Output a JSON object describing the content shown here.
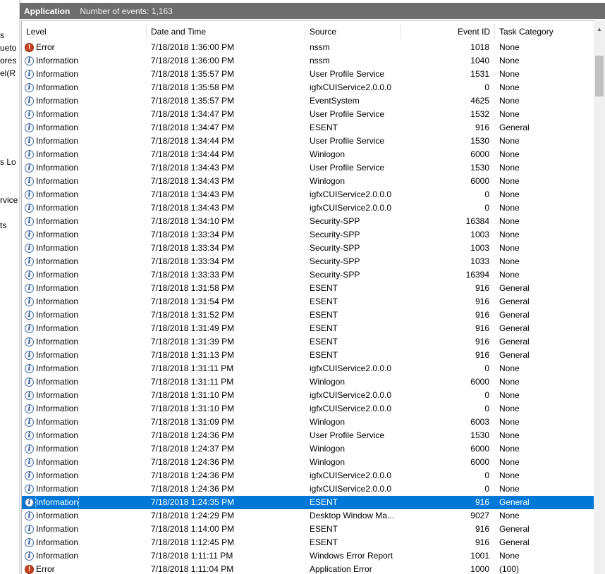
{
  "left_tree": [
    "s",
    "ueto",
    "ores",
    "el(R",
    "s Lo",
    "rvice",
    "ts"
  ],
  "header": {
    "log_name": "Application",
    "event_count": "Number of events: 1,163"
  },
  "columns": {
    "level": "Level",
    "date": "Date and Time",
    "source": "Source",
    "event_id": "Event ID",
    "task_category": "Task Category"
  },
  "icons": {
    "information": "information-icon",
    "error": "error-icon"
  },
  "colors": {
    "selection": "#0078d7",
    "header_bar": "#6d6d6d",
    "error_icon": "#c7421f"
  },
  "events": [
    {
      "level": "Error",
      "date": "7/18/2018 1:36:00 PM",
      "source": "nssm",
      "event_id": "1018",
      "category": "None"
    },
    {
      "level": "Information",
      "date": "7/18/2018 1:36:00 PM",
      "source": "nssm",
      "event_id": "1040",
      "category": "None"
    },
    {
      "level": "Information",
      "date": "7/18/2018 1:35:57 PM",
      "source": "User Profile Service",
      "event_id": "1531",
      "category": "None"
    },
    {
      "level": "Information",
      "date": "7/18/2018 1:35:58 PM",
      "source": "igfxCUIService2.0.0.0",
      "event_id": "0",
      "category": "None"
    },
    {
      "level": "Information",
      "date": "7/18/2018 1:35:57 PM",
      "source": "EventSystem",
      "event_id": "4625",
      "category": "None"
    },
    {
      "level": "Information",
      "date": "7/18/2018 1:34:47 PM",
      "source": "User Profile Service",
      "event_id": "1532",
      "category": "None"
    },
    {
      "level": "Information",
      "date": "7/18/2018 1:34:47 PM",
      "source": "ESENT",
      "event_id": "916",
      "category": "General"
    },
    {
      "level": "Information",
      "date": "7/18/2018 1:34:44 PM",
      "source": "User Profile Service",
      "event_id": "1530",
      "category": "None"
    },
    {
      "level": "Information",
      "date": "7/18/2018 1:34:44 PM",
      "source": "Winlogon",
      "event_id": "6000",
      "category": "None"
    },
    {
      "level": "Information",
      "date": "7/18/2018 1:34:43 PM",
      "source": "User Profile Service",
      "event_id": "1530",
      "category": "None"
    },
    {
      "level": "Information",
      "date": "7/18/2018 1:34:43 PM",
      "source": "Winlogon",
      "event_id": "6000",
      "category": "None"
    },
    {
      "level": "Information",
      "date": "7/18/2018 1:34:43 PM",
      "source": "igfxCUIService2.0.0.0",
      "event_id": "0",
      "category": "None"
    },
    {
      "level": "Information",
      "date": "7/18/2018 1:34:43 PM",
      "source": "igfxCUIService2.0.0.0",
      "event_id": "0",
      "category": "None"
    },
    {
      "level": "Information",
      "date": "7/18/2018 1:34:10 PM",
      "source": "Security-SPP",
      "event_id": "16384",
      "category": "None"
    },
    {
      "level": "Information",
      "date": "7/18/2018 1:33:34 PM",
      "source": "Security-SPP",
      "event_id": "1003",
      "category": "None"
    },
    {
      "level": "Information",
      "date": "7/18/2018 1:33:34 PM",
      "source": "Security-SPP",
      "event_id": "1003",
      "category": "None"
    },
    {
      "level": "Information",
      "date": "7/18/2018 1:33:34 PM",
      "source": "Security-SPP",
      "event_id": "1033",
      "category": "None"
    },
    {
      "level": "Information",
      "date": "7/18/2018 1:33:33 PM",
      "source": "Security-SPP",
      "event_id": "16394",
      "category": "None"
    },
    {
      "level": "Information",
      "date": "7/18/2018 1:31:58 PM",
      "source": "ESENT",
      "event_id": "916",
      "category": "General"
    },
    {
      "level": "Information",
      "date": "7/18/2018 1:31:54 PM",
      "source": "ESENT",
      "event_id": "916",
      "category": "General"
    },
    {
      "level": "Information",
      "date": "7/18/2018 1:31:52 PM",
      "source": "ESENT",
      "event_id": "916",
      "category": "General"
    },
    {
      "level": "Information",
      "date": "7/18/2018 1:31:49 PM",
      "source": "ESENT",
      "event_id": "916",
      "category": "General"
    },
    {
      "level": "Information",
      "date": "7/18/2018 1:31:39 PM",
      "source": "ESENT",
      "event_id": "916",
      "category": "General"
    },
    {
      "level": "Information",
      "date": "7/18/2018 1:31:13 PM",
      "source": "ESENT",
      "event_id": "916",
      "category": "General"
    },
    {
      "level": "Information",
      "date": "7/18/2018 1:31:11 PM",
      "source": "igfxCUIService2.0.0.0",
      "event_id": "0",
      "category": "None"
    },
    {
      "level": "Information",
      "date": "7/18/2018 1:31:11 PM",
      "source": "Winlogon",
      "event_id": "6000",
      "category": "None"
    },
    {
      "level": "Information",
      "date": "7/18/2018 1:31:10 PM",
      "source": "igfxCUIService2.0.0.0",
      "event_id": "0",
      "category": "None"
    },
    {
      "level": "Information",
      "date": "7/18/2018 1:31:10 PM",
      "source": "igfxCUIService2.0.0.0",
      "event_id": "0",
      "category": "None"
    },
    {
      "level": "Information",
      "date": "7/18/2018 1:31:09 PM",
      "source": "Winlogon",
      "event_id": "6003",
      "category": "None"
    },
    {
      "level": "Information",
      "date": "7/18/2018 1:24:36 PM",
      "source": "User Profile Service",
      "event_id": "1530",
      "category": "None"
    },
    {
      "level": "Information",
      "date": "7/18/2018 1:24:37 PM",
      "source": "Winlogon",
      "event_id": "6000",
      "category": "None"
    },
    {
      "level": "Information",
      "date": "7/18/2018 1:24:36 PM",
      "source": "Winlogon",
      "event_id": "6000",
      "category": "None"
    },
    {
      "level": "Information",
      "date": "7/18/2018 1:24:36 PM",
      "source": "igfxCUIService2.0.0.0",
      "event_id": "0",
      "category": "None"
    },
    {
      "level": "Information",
      "date": "7/18/2018 1:24:36 PM",
      "source": "igfxCUIService2.0.0.0",
      "event_id": "0",
      "category": "None"
    },
    {
      "level": "Information",
      "date": "7/18/2018 1:24:35 PM",
      "source": "ESENT",
      "event_id": "916",
      "category": "General",
      "selected": true
    },
    {
      "level": "Information",
      "date": "7/18/2018 1:24:29 PM",
      "source": "Desktop Window Ma...",
      "event_id": "9027",
      "category": "None"
    },
    {
      "level": "Information",
      "date": "7/18/2018 1:14:00 PM",
      "source": "ESENT",
      "event_id": "916",
      "category": "General"
    },
    {
      "level": "Information",
      "date": "7/18/2018 1:12:45 PM",
      "source": "ESENT",
      "event_id": "916",
      "category": "General"
    },
    {
      "level": "Information",
      "date": "7/18/2018 1:11:11 PM",
      "source": "Windows Error Report",
      "event_id": "1001",
      "category": "None"
    },
    {
      "level": "Error",
      "date": "7/18/2018 1:11:04 PM",
      "source": "Application Error",
      "event_id": "1000",
      "category": "(100)"
    }
  ]
}
